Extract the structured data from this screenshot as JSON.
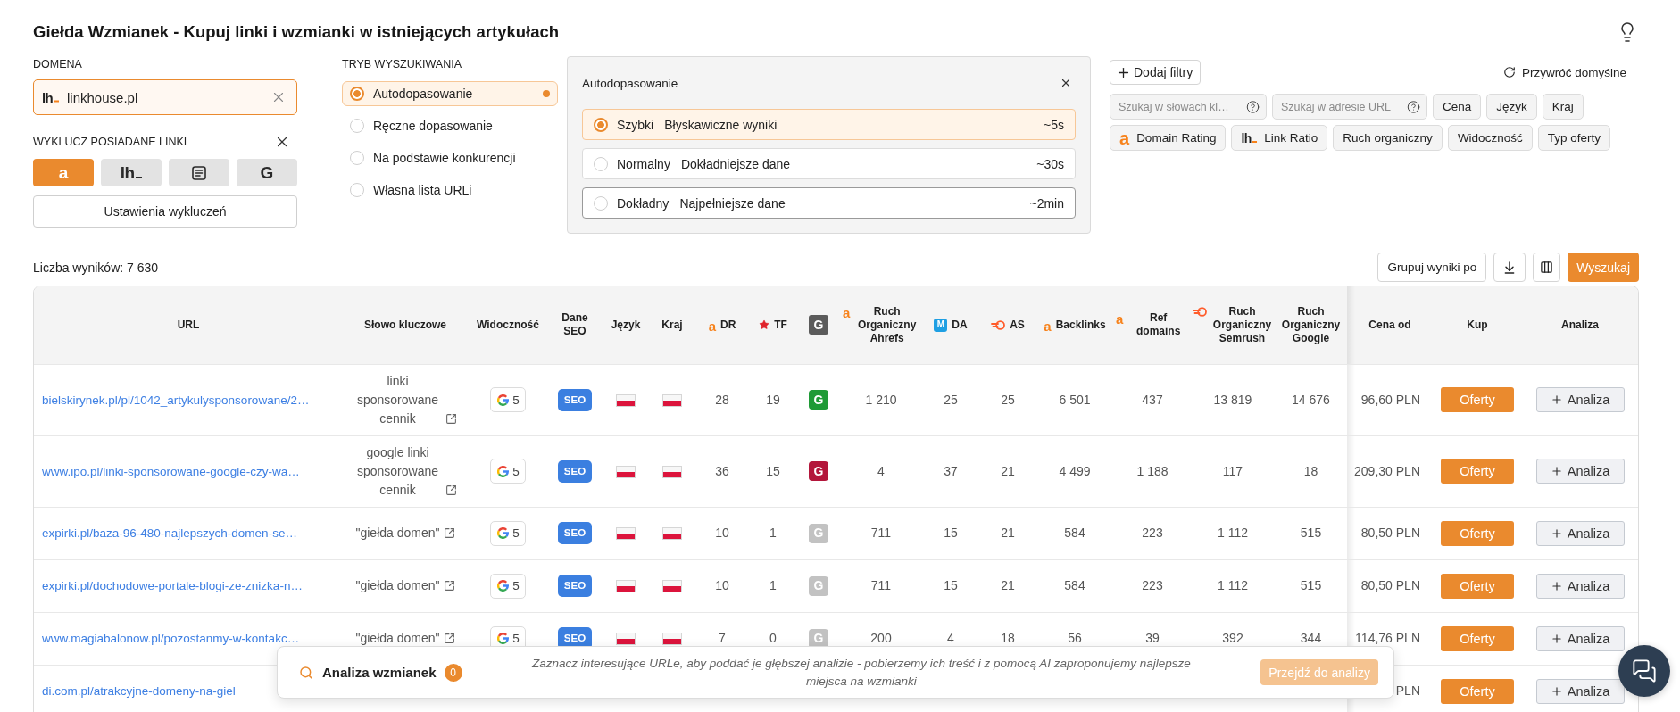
{
  "page": {
    "title": "Giełda Wzmianek - Kupuj linki i wzmianki w istniejących artykułach"
  },
  "domain": {
    "label": "DOMENA",
    "logo": {
      "kind": "lh_mark",
      "mark": "lh"
    },
    "value": "linkhouse.pl"
  },
  "exclude": {
    "label": "WYKLUCZ POSIADANE LINKI",
    "sources": [
      {
        "kind": "letter",
        "mark": "a",
        "selected": true
      },
      {
        "kind": "lh_mark",
        "mark": "lh",
        "selected": false
      },
      {
        "kind": "document",
        "selected": false
      },
      {
        "kind": "letter",
        "mark": "G",
        "selected": false
      }
    ],
    "settings_button": "Ustawienia wykluczeń"
  },
  "search_mode": {
    "label": "TRYB WYSZUKIWANIA",
    "options": [
      {
        "label": "Autodopasowanie",
        "selected": true
      },
      {
        "label": "Ręczne dopasowanie",
        "selected": false
      },
      {
        "label": "Na podstawie konkurencji",
        "selected": false
      },
      {
        "label": "Własna lista URLi",
        "selected": false
      }
    ]
  },
  "mode_panel": {
    "title": "Autodopasowanie",
    "speeds": [
      {
        "name": "Szybki",
        "description": "Błyskawiczne wyniki",
        "time": "~5s",
        "selected": true,
        "hovered": false
      },
      {
        "name": "Normalny",
        "description": "Dokładniejsze dane",
        "time": "~30s",
        "selected": false,
        "hovered": false
      },
      {
        "name": "Dokładny",
        "description": "Najpełniejsze dane",
        "time": "~2min",
        "selected": false,
        "hovered": true
      }
    ]
  },
  "filters": {
    "add_button": "Dodaj filtry",
    "reset_button": "Przywróć domyślne",
    "search_fields": [
      {
        "placeholder": "Szukaj w słowach kl…"
      },
      {
        "placeholder": "Szukaj w adresie URL"
      }
    ],
    "chips": [
      {
        "label": "Cena"
      },
      {
        "label": "Język"
      },
      {
        "label": "Kraj"
      },
      {
        "label": "Domain Rating",
        "logo": {
          "kind": "letter",
          "mark": "a"
        }
      },
      {
        "label": "Link Ratio",
        "logo": {
          "kind": "lh_mark",
          "mark": "lh"
        }
      },
      {
        "label": "Ruch organiczny"
      },
      {
        "label": "Widoczność"
      },
      {
        "label": "Typ oferty"
      }
    ]
  },
  "results": {
    "count": "Liczba wyników: 7 630",
    "group_button": "Grupuj wyniki po",
    "search_button": "Wyszukaj"
  },
  "table": {
    "columns": [
      {
        "label": "URL"
      },
      {
        "label": "Słowo kluczowe"
      },
      {
        "label": "Widoczność"
      },
      {
        "label": "Dane SEO"
      },
      {
        "label": "Język"
      },
      {
        "label": "Kraj"
      },
      {
        "label": "DR",
        "logo": {
          "kind": "letter",
          "mark": "a"
        }
      },
      {
        "label": "TF",
        "logo": {
          "kind": "star"
        }
      },
      {
        "logo": {
          "kind": "dark_tile",
          "mark": "G"
        }
      },
      {
        "label": "Ruch Organiczny Ahrefs",
        "logo": {
          "kind": "letter",
          "mark": "a"
        }
      },
      {
        "label": "DA",
        "logo": {
          "kind": "blue_tile",
          "mark": "M"
        }
      },
      {
        "label": "AS",
        "logo": {
          "kind": "swirl"
        }
      },
      {
        "label": "Backlinks",
        "logo": {
          "kind": "letter",
          "mark": "a"
        }
      },
      {
        "label": "Ref domains",
        "logo": {
          "kind": "letter",
          "mark": "a"
        }
      },
      {
        "label": "Ruch Organiczny Semrush",
        "logo": {
          "kind": "swirl"
        }
      },
      {
        "label": "Ruch Organiczny Google"
      },
      {
        "label": "Cena od"
      },
      {
        "label": "Kup"
      },
      {
        "label": "Analiza"
      }
    ],
    "rows": [
      {
        "kind": "full",
        "url": "bielskirynek.pl/pl/1042_artykulysponsorowane/2…",
        "keyword": "linki sponsorowane cennik",
        "visibility": "5",
        "seo": "SEO",
        "dr": "28",
        "tf": "19",
        "g_index": {
          "mark": "G",
          "color": "#1f9a36"
        },
        "ahrefs_traffic": "1 210",
        "da": "25",
        "as": "25",
        "backlinks": "6 501",
        "ref_domains": "437",
        "semrush_traffic": "13 819",
        "google_traffic": "14 676",
        "price": "96,60 PLN",
        "buy": "Oferty",
        "analysis": "Analiza"
      },
      {
        "kind": "full",
        "url": "www.ipo.pl/linki-sponsorowane-google-czy-wa…",
        "keyword": "google linki sponsorowane cennik",
        "visibility": "5",
        "seo": "SEO",
        "dr": "36",
        "tf": "15",
        "g_index": {
          "mark": "G",
          "color": "#b3163b"
        },
        "ahrefs_traffic": "4",
        "da": "37",
        "as": "21",
        "backlinks": "4 499",
        "ref_domains": "1 188",
        "semrush_traffic": "117",
        "google_traffic": "18",
        "price": "209,30 PLN",
        "buy": "Oferty",
        "analysis": "Analiza"
      },
      {
        "kind": "full",
        "url": "expirki.pl/baza-96-480-najlepszych-domen-se…",
        "keyword": "\"giełda domen\"",
        "visibility": "5",
        "seo": "SEO",
        "dr": "10",
        "tf": "1",
        "g_index": {
          "mark": "G",
          "color": "#c2c2c2"
        },
        "ahrefs_traffic": "711",
        "da": "15",
        "as": "21",
        "backlinks": "584",
        "ref_domains": "223",
        "semrush_traffic": "1 112",
        "google_traffic": "515",
        "price": "80,50 PLN",
        "buy": "Oferty",
        "analysis": "Analiza"
      },
      {
        "kind": "full",
        "url": "expirki.pl/dochodowe-portale-blogi-ze-znizka-n…",
        "keyword": "\"giełda domen\"",
        "visibility": "5",
        "seo": "SEO",
        "dr": "10",
        "tf": "1",
        "g_index": {
          "mark": "G",
          "color": "#c2c2c2"
        },
        "ahrefs_traffic": "711",
        "da": "15",
        "as": "21",
        "backlinks": "584",
        "ref_domains": "223",
        "semrush_traffic": "1 112",
        "google_traffic": "515",
        "price": "80,50 PLN",
        "buy": "Oferty",
        "analysis": "Analiza"
      },
      {
        "kind": "full",
        "url": "www.magiabalonow.pl/pozostanmy-w-kontakc…",
        "keyword": "\"giełda domen\"",
        "visibility": "5",
        "seo": "SEO",
        "dr": "7",
        "tf": "0",
        "g_index": {
          "mark": "G",
          "color": "#c2c2c2"
        },
        "ahrefs_traffic": "200",
        "da": "4",
        "as": "18",
        "backlinks": "56",
        "ref_domains": "39",
        "semrush_traffic": "392",
        "google_traffic": "344",
        "price": "114,76 PLN",
        "buy": "Oferty",
        "analysis": "Analiza"
      },
      {
        "kind": "partly_covered",
        "url": "di.com.pl/atrakcyjne-domeny-na-giel",
        "price": "PLN",
        "buy": "Oferty",
        "analysis": "Analiza"
      }
    ]
  },
  "mention_analysis": {
    "title": "Analiza wzmianek",
    "count": "0",
    "hint": "Zaznacz interesujące URLe, aby poddać je głębszej analizie - pobierzemy ich treść i z pomocą AI zaproponujemy najlepsze miejsca na wzmianki",
    "button": "Przejdź do analizy",
    "button_disabled": true
  }
}
